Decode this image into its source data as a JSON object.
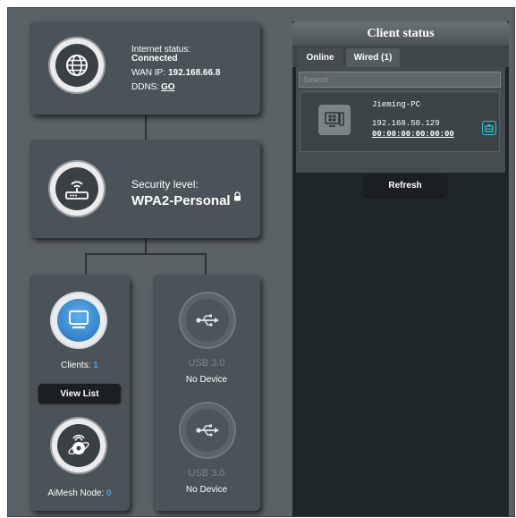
{
  "internet": {
    "status_label": "Internet status:",
    "status_value": "Connected",
    "wan_label": "WAN IP:",
    "wan_value": "192.168.66.8",
    "ddns_label": "DDNS:",
    "ddns_link": "GO"
  },
  "security": {
    "label": "Security level:",
    "value": "WPA2-Personal"
  },
  "clients": {
    "label": "Clients:",
    "count": "1",
    "view_list": "View List"
  },
  "aimesh": {
    "label": "AiMesh Node:",
    "count": "0"
  },
  "usb": [
    {
      "port": "USB 3.0",
      "status": "No Device"
    },
    {
      "port": "USB 3.0",
      "status": "No Device"
    }
  ],
  "client_status": {
    "title": "Client status",
    "tabs": [
      "Online",
      "Wired (1)"
    ],
    "search_placeholder": "Search",
    "client": {
      "name": "Jieming-PC",
      "ip": "192.168.50.129",
      "mac": "00:00:00:00:00:00"
    },
    "refresh": "Refresh"
  },
  "colors": {
    "card": "#4a5357",
    "background": "#5b6266",
    "client_count_blue": "#4aa3e8",
    "wired_icon_teal": "#29c5d3"
  }
}
